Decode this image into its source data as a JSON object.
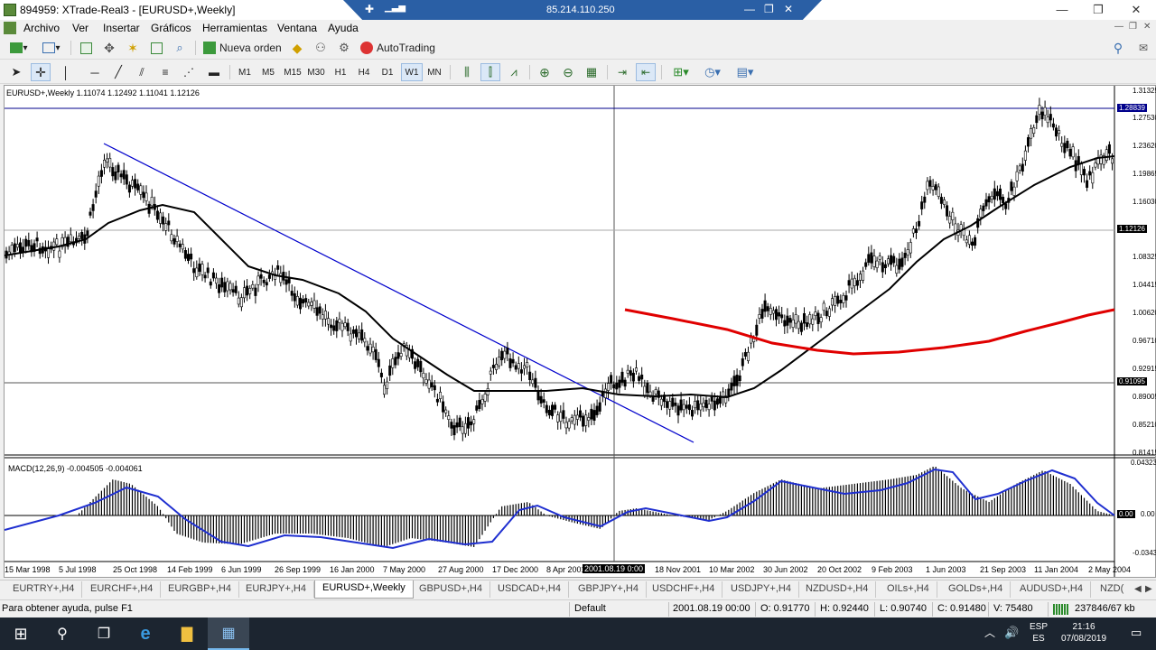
{
  "window": {
    "title": "894959: XTrade-Real3 - [EURUSD+,Weekly]",
    "remote_ip": "85.214.110.250"
  },
  "menu": [
    "Archivo",
    "Ver",
    "Insertar",
    "Gráficos",
    "Herramientas",
    "Ventana",
    "Ayuda"
  ],
  "toolbar1": {
    "new_order": "Nueva orden",
    "autotrading": "AutoTrading"
  },
  "toolbar2": {
    "timeframes": [
      "M1",
      "M5",
      "M15",
      "M30",
      "H1",
      "H4",
      "D1",
      "W1",
      "MN"
    ],
    "active_timeframe": "W1"
  },
  "chart": {
    "legend": "EURUSD+,Weekly  1.11074 1.12492 1.11041 1.12126",
    "price_labels": [
      "1.31325",
      "1.27530",
      "1.23620",
      "1.19865",
      "1.16030",
      "1.08325",
      "1.04415",
      "1.00620",
      "0.96710",
      "0.92915",
      "0.89005",
      "0.85210",
      "0.81415"
    ],
    "badge_hline": "1.28839",
    "badge_bid": "1.12126",
    "badge_cursor": "0.91095",
    "macd_legend": "MACD(12,26,9) -0.004505 -0.004061",
    "macd_labels": [
      "0.043232",
      "0.00",
      "-0.03434"
    ],
    "macd_badge": "0.00",
    "time_labels": [
      "15 Mar 1998",
      "5 Jul 1998",
      "25 Oct 1998",
      "14 Feb 1999",
      "6 Jun 1999",
      "26 Sep 1999",
      "16 Jan 2000",
      "7 May 2000",
      "27 Aug 2000",
      "17 Dec 2000",
      "8 Apr 2001",
      "18 Nov 2001",
      "10 Mar 2002",
      "30 Jun 2002",
      "20 Oct 2002",
      "9 Feb 2003",
      "1 Jun 2003",
      "21 Sep 2003",
      "11 Jan 2004",
      "2 May 2004"
    ],
    "time_cursor": "2001.08.19 0:00",
    "colors": {
      "trendline": "#0000cc",
      "ma_fast": "#000000",
      "ma_slow": "#e00000",
      "macd_signal": "#1f2fd0",
      "hline": "#00008b"
    }
  },
  "tabs": [
    "EURTRY+,H4",
    "EURCHF+,H4",
    "EURGBP+,H4",
    "EURJPY+,H4",
    "EURUSD+,Weekly",
    "GBPUSD+,H4",
    "USDCAD+,H4",
    "GBPJPY+,H4",
    "USDCHF+,H4",
    "USDJPY+,H4",
    "NZDUSD+,H4",
    "OILs+,H4",
    "GOLDs+,H4",
    "AUDUSD+,H4",
    "NZD("
  ],
  "active_tab": "EURUSD+,Weekly",
  "status": {
    "help": "Para obtener ayuda, pulse F1",
    "profile": "Default",
    "datetime": "2001.08.19 00:00",
    "open": "O: 0.91770",
    "high": "H: 0.92440",
    "low": "L: 0.90740",
    "close": "C: 0.91480",
    "volume": "V: 75480",
    "traffic": "237846/67 kb"
  },
  "taskbar": {
    "lang1": "ESP",
    "lang2": "ES",
    "time": "21:16",
    "date": "07/08/2019"
  }
}
